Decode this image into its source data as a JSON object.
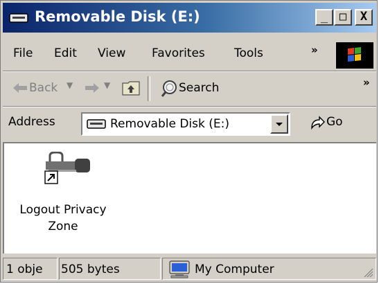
{
  "window": {
    "title": "Removable Disk (E:)",
    "controls": {
      "minimize": "_",
      "maximize": "□",
      "close": "X"
    }
  },
  "menu": {
    "items": [
      "File",
      "Edit",
      "View",
      "Favorites",
      "Tools"
    ],
    "overflow": "»"
  },
  "toolbar": {
    "back_label": "Back",
    "search_label": "Search",
    "overflow": "»"
  },
  "address": {
    "label": "Address",
    "value": "Removable Disk (E:)",
    "go_label": "Go"
  },
  "files": [
    {
      "name": "Logout Privacy Zone",
      "type": "shortcut",
      "icon": "padlock-key-icon"
    }
  ],
  "status": {
    "objects": "1 obje",
    "size": "505 bytes",
    "zone": "My Computer"
  },
  "colors": {
    "titlebar_start": "#0a246a",
    "titlebar_end": "#a6caf0",
    "chrome": "#d4d0c8"
  }
}
